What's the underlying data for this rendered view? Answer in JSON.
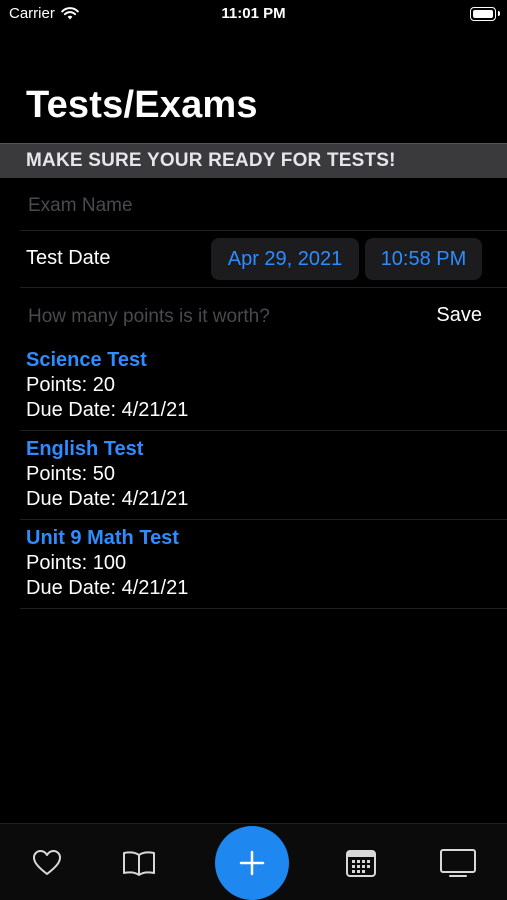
{
  "status_bar": {
    "carrier": "Carrier",
    "time": "11:01 PM"
  },
  "title": "Tests/Exams",
  "section_header": "MAKE SURE YOUR READY FOR TESTS!",
  "form": {
    "exam_name_placeholder": "Exam Name",
    "test_date_label": "Test Date",
    "date_value": "Apr 29, 2021",
    "time_value": "10:58 PM",
    "points_placeholder": "How many points is it worth?",
    "save_label": "Save"
  },
  "exams": [
    {
      "title": "Science Test",
      "points": "Points: 20",
      "due": "Due Date: 4/21/21"
    },
    {
      "title": "English Test",
      "points": "Points: 50",
      "due": "Due Date: 4/21/21"
    },
    {
      "title": "Unit 9 Math Test",
      "points": "Points: 100",
      "due": "Due Date: 4/21/21"
    }
  ],
  "tab_bar": {
    "icons": [
      "heart-icon",
      "book-icon",
      "plus-icon",
      "calendar-icon",
      "tv-icon"
    ]
  },
  "colors": {
    "accent": "#2f8cff",
    "fab": "#1e87f0",
    "background": "#000000",
    "section_header_bg": "#3a3a3c"
  }
}
